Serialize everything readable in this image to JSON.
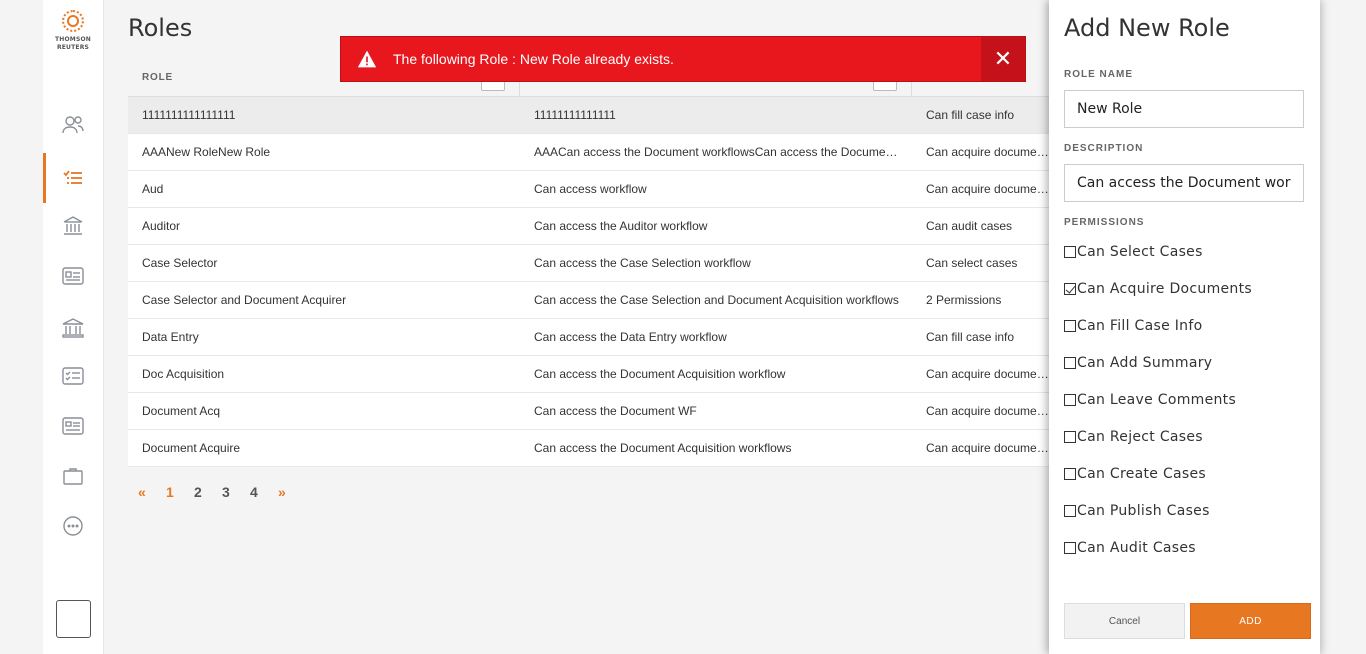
{
  "nav": {
    "logo_line1": "THOMSON",
    "logo_line2": "REUTERS",
    "items": [
      {
        "icon": "users-icon"
      },
      {
        "icon": "roles-list-icon",
        "active": true
      },
      {
        "icon": "institution-icon"
      },
      {
        "icon": "id-card-icon"
      },
      {
        "icon": "bank-icon"
      },
      {
        "icon": "checklist-icon"
      },
      {
        "icon": "contact-card-icon"
      },
      {
        "icon": "briefcase-icon"
      },
      {
        "icon": "more-icon"
      }
    ],
    "accent": "#e87722"
  },
  "page": {
    "title": "Roles"
  },
  "table": {
    "columns": [
      "ROLE",
      "",
      ""
    ],
    "rows": [
      {
        "role": "1111111111111111",
        "description": "11111111111111",
        "permissions": "Can fill case info",
        "selected": true
      },
      {
        "role": "AAANew RoleNew Role",
        "description": "AAACan access the Document workflowsCan access the Document Acquisition workflow",
        "permissions": "Can acquire documents"
      },
      {
        "role": "Aud",
        "description": "Can access workflow",
        "permissions": "Can acquire documents"
      },
      {
        "role": "Auditor",
        "description": "Can access the Auditor workflow",
        "permissions": "Can audit cases"
      },
      {
        "role": "Case Selector",
        "description": "Can access the Case Selection workflow",
        "permissions": "Can select cases"
      },
      {
        "role": "Case Selector and Document Acquirer",
        "description": "Can access the Case Selection and Document Acquisition workflows",
        "permissions": "2 Permissions"
      },
      {
        "role": "Data Entry",
        "description": "Can access the Data Entry workflow",
        "permissions": "Can fill case info"
      },
      {
        "role": "Doc Acquisition",
        "description": "Can access the Document Acquisition workflow",
        "permissions": "Can acquire documents"
      },
      {
        "role": "Document Acq",
        "description": "Can access the Document WF",
        "permissions": "Can acquire documents"
      },
      {
        "role": "Document Acquire",
        "description": "Can access the Document Acquisition workflows",
        "permissions": "Can acquire documents"
      }
    ]
  },
  "pager": {
    "prev": "«",
    "pages": [
      "1",
      "2",
      "3",
      "4"
    ],
    "current": "1",
    "next": "»"
  },
  "alert": {
    "message": "The following Role : New Role already exists.",
    "color": "#e8171e"
  },
  "panel": {
    "title": "Add New Role",
    "role_name_label": "ROLE NAME",
    "role_name_value": "New Role",
    "description_label": "DESCRIPTION",
    "description_value": "Can access the Document workflows",
    "permissions_label": "PERMISSIONS",
    "permissions": [
      {
        "label": "Can Select Cases",
        "checked": false
      },
      {
        "label": "Can Acquire Documents",
        "checked": true
      },
      {
        "label": "Can Fill Case Info",
        "checked": false
      },
      {
        "label": "Can Add Summary",
        "checked": false
      },
      {
        "label": "Can Leave Comments",
        "checked": false
      },
      {
        "label": "Can Reject Cases",
        "checked": false
      },
      {
        "label": "Can Create Cases",
        "checked": false
      },
      {
        "label": "Can Publish Cases",
        "checked": false
      },
      {
        "label": "Can Audit Cases",
        "checked": false
      }
    ],
    "cancel_label": "Cancel",
    "add_label": "ADD"
  }
}
